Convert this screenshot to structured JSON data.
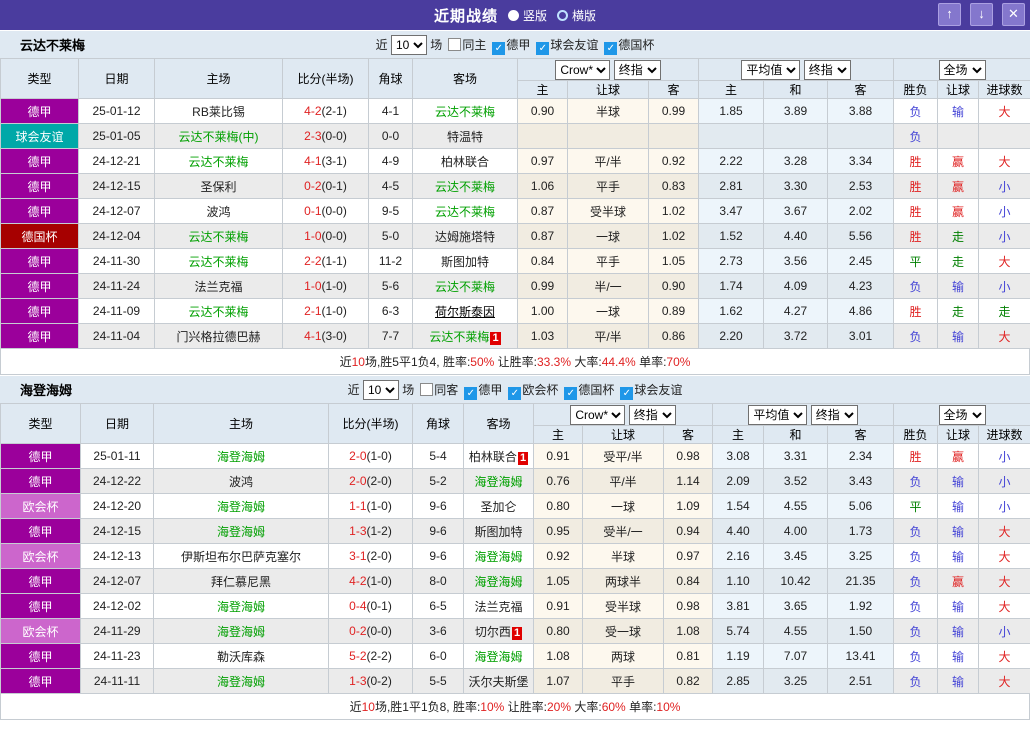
{
  "titlebar": {
    "title": "近期战绩",
    "radios": [
      {
        "label": "竖版",
        "selected": true
      },
      {
        "label": "横版",
        "selected": false
      }
    ],
    "up_icon": "↑",
    "down_icon": "↓",
    "close_icon": "✕"
  },
  "colors": {
    "titlebar_bg": "#4a3c9e",
    "header_bg": "#dfe9f2",
    "team_highlight": "#00a000",
    "score_red": "#e02222",
    "league": {
      "德甲": "#9b009b",
      "球会友谊": "#00a8a8",
      "德国杯": "#a60000",
      "欧会杯": "#cc66cc"
    },
    "result": {
      "胜": "#e02222",
      "赢": "#e02222",
      "大": "#e02222",
      "负": "#4343d6",
      "输": "#4343d6",
      "小": "#4343d6",
      "平": "#008000",
      "走": "#008000"
    }
  },
  "table_columns": {
    "left": [
      "类型",
      "日期",
      "主场",
      "比分(半场)",
      "角球",
      "客场"
    ],
    "sub": [
      "主",
      "让球",
      "客",
      "主",
      "和",
      "客",
      "胜负",
      "让球",
      "进球数"
    ]
  },
  "sections": [
    {
      "team": "云达不莱梅",
      "filter": {
        "near": "近",
        "count": "10",
        "games": "场",
        "same": {
          "label": "同主",
          "checked": false
        },
        "leagues": [
          {
            "label": "德甲",
            "checked": true
          },
          {
            "label": "球会友谊",
            "checked": true
          },
          {
            "label": "德国杯",
            "checked": true
          }
        ]
      },
      "selects": [
        "Crow*",
        "终指",
        "平均值",
        "终指",
        "全场"
      ],
      "rows": [
        {
          "league": "德甲",
          "date": "25-01-12",
          "home": "RB莱比锡",
          "home_hl": false,
          "score": "4-2",
          "half": "(2-1)",
          "corner": "4-1",
          "away": "云达不莱梅",
          "away_hl": true,
          "away_badge": "",
          "away_link": false,
          "odds": [
            "0.90",
            "半球",
            "0.99"
          ],
          "avg": [
            "1.85",
            "3.89",
            "3.88"
          ],
          "result": [
            "负",
            "输",
            "大"
          ]
        },
        {
          "league": "球会友谊",
          "date": "25-01-05",
          "home": "云达不莱梅(中)",
          "home_hl": true,
          "score": "2-3",
          "half": "(0-0)",
          "corner": "0-0",
          "away": "特温特",
          "away_hl": false,
          "away_badge": "",
          "away_link": false,
          "odds": [
            "",
            "",
            ""
          ],
          "avg": [
            "",
            "",
            ""
          ],
          "result": [
            "负",
            "",
            ""
          ]
        },
        {
          "league": "德甲",
          "date": "24-12-21",
          "home": "云达不莱梅",
          "home_hl": true,
          "score": "4-1",
          "half": "(3-1)",
          "corner": "4-9",
          "away": "柏林联合",
          "away_hl": false,
          "away_badge": "",
          "away_link": false,
          "odds": [
            "0.97",
            "平/半",
            "0.92"
          ],
          "avg": [
            "2.22",
            "3.28",
            "3.34"
          ],
          "result": [
            "胜",
            "赢",
            "大"
          ]
        },
        {
          "league": "德甲",
          "date": "24-12-15",
          "home": "圣保利",
          "home_hl": false,
          "score": "0-2",
          "half": "(0-1)",
          "corner": "4-5",
          "away": "云达不莱梅",
          "away_hl": true,
          "away_badge": "",
          "away_link": false,
          "odds": [
            "1.06",
            "平手",
            "0.83"
          ],
          "avg": [
            "2.81",
            "3.30",
            "2.53"
          ],
          "result": [
            "胜",
            "赢",
            "小"
          ]
        },
        {
          "league": "德甲",
          "date": "24-12-07",
          "home": "波鸿",
          "home_hl": false,
          "score": "0-1",
          "half": "(0-0)",
          "corner": "9-5",
          "away": "云达不莱梅",
          "away_hl": true,
          "away_badge": "",
          "away_link": false,
          "odds": [
            "0.87",
            "受半球",
            "1.02"
          ],
          "avg": [
            "3.47",
            "3.67",
            "2.02"
          ],
          "result": [
            "胜",
            "赢",
            "小"
          ]
        },
        {
          "league": "德国杯",
          "date": "24-12-04",
          "home": "云达不莱梅",
          "home_hl": true,
          "score": "1-0",
          "half": "(0-0)",
          "corner": "5-0",
          "away": "达姆施塔特",
          "away_hl": false,
          "away_badge": "",
          "away_link": false,
          "odds": [
            "0.87",
            "一球",
            "1.02"
          ],
          "avg": [
            "1.52",
            "4.40",
            "5.56"
          ],
          "result": [
            "胜",
            "走",
            "小"
          ]
        },
        {
          "league": "德甲",
          "date": "24-11-30",
          "home": "云达不莱梅",
          "home_hl": true,
          "score": "2-2",
          "half": "(1-1)",
          "corner": "11-2",
          "away": "斯图加特",
          "away_hl": false,
          "away_badge": "",
          "away_link": false,
          "odds": [
            "0.84",
            "平手",
            "1.05"
          ],
          "avg": [
            "2.73",
            "3.56",
            "2.45"
          ],
          "result": [
            "平",
            "走",
            "大"
          ]
        },
        {
          "league": "德甲",
          "date": "24-11-24",
          "home": "法兰克福",
          "home_hl": false,
          "score": "1-0",
          "half": "(1-0)",
          "corner": "5-6",
          "away": "云达不莱梅",
          "away_hl": true,
          "away_badge": "",
          "away_link": false,
          "odds": [
            "0.99",
            "半/一",
            "0.90"
          ],
          "avg": [
            "1.74",
            "4.09",
            "4.23"
          ],
          "result": [
            "负",
            "输",
            "小"
          ]
        },
        {
          "league": "德甲",
          "date": "24-11-09",
          "home": "云达不莱梅",
          "home_hl": true,
          "score": "2-1",
          "half": "(1-0)",
          "corner": "6-3",
          "away": "荷尔斯泰因",
          "away_hl": false,
          "away_badge": "",
          "away_link": true,
          "odds": [
            "1.00",
            "一球",
            "0.89"
          ],
          "avg": [
            "1.62",
            "4.27",
            "4.86"
          ],
          "result": [
            "胜",
            "走",
            "走"
          ]
        },
        {
          "league": "德甲",
          "date": "24-11-04",
          "home": "门兴格拉德巴赫",
          "home_hl": false,
          "score": "4-1",
          "half": "(3-0)",
          "corner": "7-7",
          "away": "云达不莱梅",
          "away_hl": true,
          "away_badge": "1",
          "away_link": false,
          "odds": [
            "1.03",
            "平/半",
            "0.86"
          ],
          "avg": [
            "2.20",
            "3.72",
            "3.01"
          ],
          "result": [
            "负",
            "输",
            "大"
          ]
        }
      ],
      "summary": [
        {
          "t": "近"
        },
        {
          "t": "10",
          "red": true
        },
        {
          "t": "场,胜5平1负4, 胜率:"
        },
        {
          "t": "50%",
          "red": true
        },
        {
          "t": " 让胜率:"
        },
        {
          "t": "33.3%",
          "red": true
        },
        {
          "t": " 大率:"
        },
        {
          "t": "44.4%",
          "red": true
        },
        {
          "t": " 单率:"
        },
        {
          "t": "70%",
          "red": true
        }
      ]
    },
    {
      "team": "海登海姆",
      "filter": {
        "near": "近",
        "count": "10",
        "games": "场",
        "same": {
          "label": "同客",
          "checked": false
        },
        "leagues": [
          {
            "label": "德甲",
            "checked": true
          },
          {
            "label": "欧会杯",
            "checked": true
          },
          {
            "label": "德国杯",
            "checked": true
          },
          {
            "label": "球会友谊",
            "checked": true
          }
        ]
      },
      "selects": [
        "Crow*",
        "终指",
        "平均值",
        "终指",
        "全场"
      ],
      "rows": [
        {
          "league": "德甲",
          "date": "25-01-11",
          "home": "海登海姆",
          "home_hl": true,
          "score": "2-0",
          "half": "(1-0)",
          "corner": "5-4",
          "away": "柏林联合",
          "away_hl": false,
          "away_badge": "1",
          "away_link": false,
          "odds": [
            "0.91",
            "受平/半",
            "0.98"
          ],
          "avg": [
            "3.08",
            "3.31",
            "2.34"
          ],
          "result": [
            "胜",
            "赢",
            "小"
          ]
        },
        {
          "league": "德甲",
          "date": "24-12-22",
          "home": "波鸿",
          "home_hl": false,
          "score": "2-0",
          "half": "(2-0)",
          "corner": "5-2",
          "away": "海登海姆",
          "away_hl": true,
          "away_badge": "",
          "away_link": false,
          "odds": [
            "0.76",
            "平/半",
            "1.14"
          ],
          "avg": [
            "2.09",
            "3.52",
            "3.43"
          ],
          "result": [
            "负",
            "输",
            "小"
          ]
        },
        {
          "league": "欧会杯",
          "date": "24-12-20",
          "home": "海登海姆",
          "home_hl": true,
          "score": "1-1",
          "half": "(1-0)",
          "corner": "9-6",
          "away": "圣加仑",
          "away_hl": false,
          "away_badge": "",
          "away_link": false,
          "odds": [
            "0.80",
            "一球",
            "1.09"
          ],
          "avg": [
            "1.54",
            "4.55",
            "5.06"
          ],
          "result": [
            "平",
            "输",
            "小"
          ]
        },
        {
          "league": "德甲",
          "date": "24-12-15",
          "home": "海登海姆",
          "home_hl": true,
          "score": "1-3",
          "half": "(1-2)",
          "corner": "9-6",
          "away": "斯图加特",
          "away_hl": false,
          "away_badge": "",
          "away_link": false,
          "odds": [
            "0.95",
            "受半/一",
            "0.94"
          ],
          "avg": [
            "4.40",
            "4.00",
            "1.73"
          ],
          "result": [
            "负",
            "输",
            "大"
          ]
        },
        {
          "league": "欧会杯",
          "date": "24-12-13",
          "home": "伊斯坦布尔巴萨克塞尔",
          "home_hl": false,
          "score": "3-1",
          "half": "(2-0)",
          "corner": "9-6",
          "away": "海登海姆",
          "away_hl": true,
          "away_badge": "",
          "away_link": false,
          "odds": [
            "0.92",
            "半球",
            "0.97"
          ],
          "avg": [
            "2.16",
            "3.45",
            "3.25"
          ],
          "result": [
            "负",
            "输",
            "大"
          ]
        },
        {
          "league": "德甲",
          "date": "24-12-07",
          "home": "拜仁慕尼黑",
          "home_hl": false,
          "score": "4-2",
          "half": "(1-0)",
          "corner": "8-0",
          "away": "海登海姆",
          "away_hl": true,
          "away_badge": "",
          "away_link": false,
          "odds": [
            "1.05",
            "两球半",
            "0.84"
          ],
          "avg": [
            "1.10",
            "10.42",
            "21.35"
          ],
          "result": [
            "负",
            "赢",
            "大"
          ]
        },
        {
          "league": "德甲",
          "date": "24-12-02",
          "home": "海登海姆",
          "home_hl": true,
          "score": "0-4",
          "half": "(0-1)",
          "corner": "6-5",
          "away": "法兰克福",
          "away_hl": false,
          "away_badge": "",
          "away_link": false,
          "odds": [
            "0.91",
            "受半球",
            "0.98"
          ],
          "avg": [
            "3.81",
            "3.65",
            "1.92"
          ],
          "result": [
            "负",
            "输",
            "大"
          ]
        },
        {
          "league": "欧会杯",
          "date": "24-11-29",
          "home": "海登海姆",
          "home_hl": true,
          "score": "0-2",
          "half": "(0-0)",
          "corner": "3-6",
          "away": "切尔西",
          "away_hl": false,
          "away_badge": "1",
          "away_link": false,
          "odds": [
            "0.80",
            "受一球",
            "1.08"
          ],
          "avg": [
            "5.74",
            "4.55",
            "1.50"
          ],
          "result": [
            "负",
            "输",
            "小"
          ]
        },
        {
          "league": "德甲",
          "date": "24-11-23",
          "home": "勒沃库森",
          "home_hl": false,
          "score": "5-2",
          "half": "(2-2)",
          "corner": "6-0",
          "away": "海登海姆",
          "away_hl": true,
          "away_badge": "",
          "away_link": false,
          "odds": [
            "1.08",
            "两球",
            "0.81"
          ],
          "avg": [
            "1.19",
            "7.07",
            "13.41"
          ],
          "result": [
            "负",
            "输",
            "大"
          ]
        },
        {
          "league": "德甲",
          "date": "24-11-11",
          "home": "海登海姆",
          "home_hl": true,
          "score": "1-3",
          "half": "(0-2)",
          "corner": "5-5",
          "away": "沃尔夫斯堡",
          "away_hl": false,
          "away_badge": "",
          "away_link": false,
          "odds": [
            "1.07",
            "平手",
            "0.82"
          ],
          "avg": [
            "2.85",
            "3.25",
            "2.51"
          ],
          "result": [
            "负",
            "输",
            "大"
          ]
        }
      ],
      "summary": [
        {
          "t": "近"
        },
        {
          "t": "10",
          "red": true
        },
        {
          "t": "场,胜1平1负8, 胜率:"
        },
        {
          "t": "10%",
          "red": true
        },
        {
          "t": " 让胜率:"
        },
        {
          "t": "20%",
          "red": true
        },
        {
          "t": " 大率:"
        },
        {
          "t": "60%",
          "red": true
        },
        {
          "t": " 单率:"
        },
        {
          "t": "10%",
          "red": true
        }
      ]
    }
  ]
}
